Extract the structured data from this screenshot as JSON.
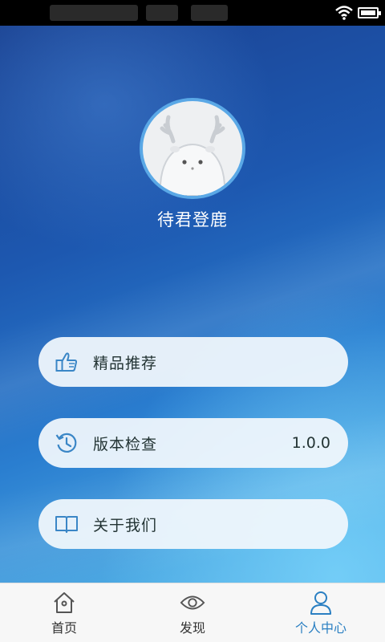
{
  "user": {
    "name": "待君登鹿"
  },
  "menu": [
    {
      "label": "精品推荐",
      "icon": "thumbs-up-icon",
      "value": ""
    },
    {
      "label": "版本检查",
      "icon": "history-icon",
      "value": "1.0.0"
    },
    {
      "label": "关于我们",
      "icon": "book-icon",
      "value": ""
    }
  ],
  "tabs": [
    {
      "label": "首页",
      "icon": "home-icon",
      "active": false
    },
    {
      "label": "发现",
      "icon": "eye-icon",
      "active": false
    },
    {
      "label": "个人中心",
      "icon": "person-icon",
      "active": true
    }
  ],
  "colors": {
    "accent": "#2a7fc2",
    "icon": "#3a86c6"
  }
}
